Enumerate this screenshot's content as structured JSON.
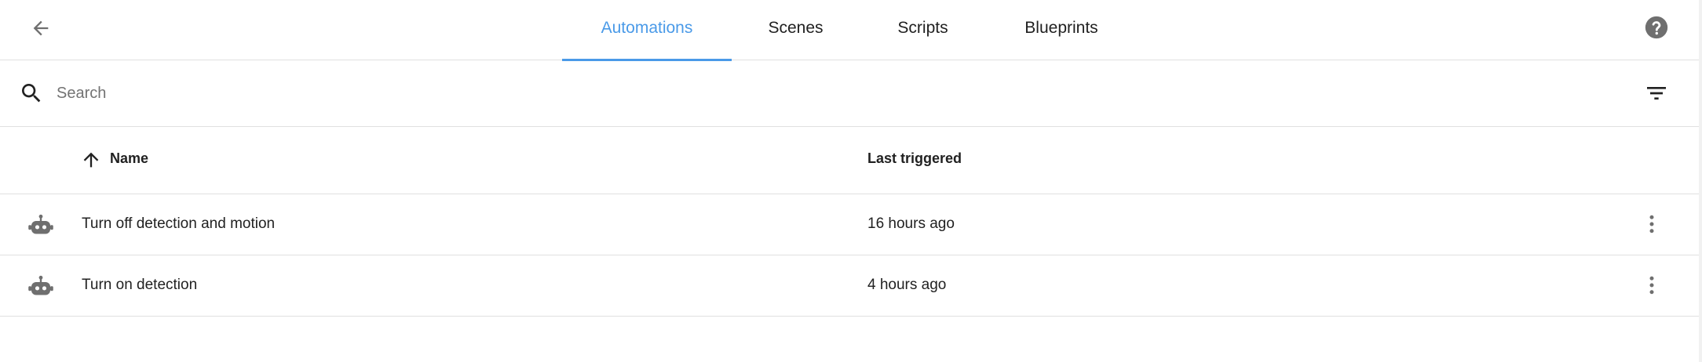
{
  "header": {
    "tabs": [
      {
        "label": "Automations",
        "active": true
      },
      {
        "label": "Scenes",
        "active": false
      },
      {
        "label": "Scripts",
        "active": false
      },
      {
        "label": "Blueprints",
        "active": false
      }
    ],
    "back_icon": "arrow-left-icon",
    "help_icon": "help-circle-icon"
  },
  "search": {
    "placeholder": "Search",
    "value": "",
    "filter_icon": "filter-icon"
  },
  "table": {
    "columns": {
      "name": "Name",
      "last_triggered": "Last triggered"
    },
    "sort_icon": "arrow-up-icon",
    "rows": [
      {
        "icon": "robot-icon",
        "name": "Turn off detection and motion",
        "last_triggered": "16 hours ago"
      },
      {
        "icon": "robot-icon",
        "name": "Turn on detection",
        "last_triggered": "4 hours ago"
      }
    ]
  },
  "colors": {
    "accent": "#4a9ae8",
    "icon": "#6f6f6f",
    "divider": "#e0e0e0"
  }
}
